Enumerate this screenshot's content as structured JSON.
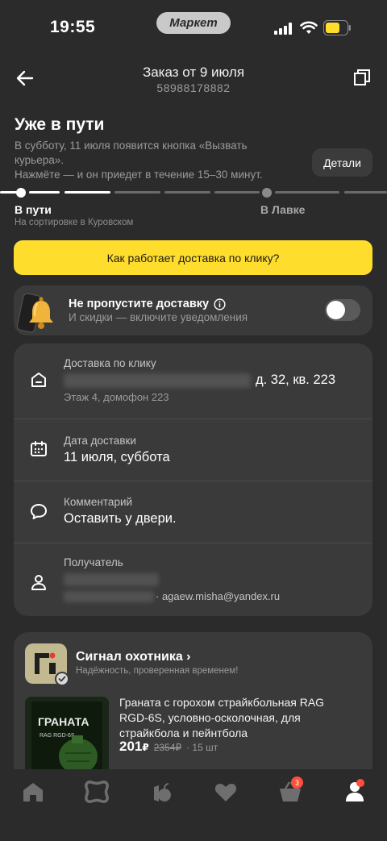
{
  "status_bar": {
    "time": "19:55",
    "pill_label": "Маркет",
    "battery_color": "#ffdd2d"
  },
  "header": {
    "title": "Заказ от 9 июля",
    "order_number": "58988178882",
    "back_icon": "arrow-left-icon",
    "copy_icon": "copy-icon"
  },
  "status": {
    "title": "Уже в пути",
    "description": "В субботу, 11 июля появится кнопка «Вызвать курьера».\nНажмёте — и он приедет в течение 15–30 минут.",
    "details_button": "Детали"
  },
  "progress": {
    "stage_current": "В пути",
    "stage_current_sub": "На сортировке в Куровском",
    "stage_next": "В Лавке",
    "accent_color": "#ffffff",
    "inactive_color": "#6a6a6a"
  },
  "delivery_button": "Как работает доставка по клику?",
  "notify": {
    "title": "Не пропустите доставку",
    "subtitle": "И скидки — включите уведомления",
    "toggle_on": false
  },
  "info": {
    "address": {
      "label": "Доставка по клику",
      "value_visible": "д. 32, кв. 223",
      "sub": "Этаж 4, домофон 223"
    },
    "date": {
      "label": "Дата доставки",
      "value": "11 июля, суббота"
    },
    "comment": {
      "label": "Комментарий",
      "value": "Оставить у двери."
    },
    "recipient": {
      "label": "Получатель",
      "email": "· agaew.misha@yandex.ru"
    }
  },
  "shop": {
    "name": "Сигнал охотника",
    "tagline": "Надёжность, проверенная временем!",
    "product_title": "Граната с горохом страйкбольная RAG RGD-6S, условно-осколочная, для страйкбола и пейнтбола",
    "price": "201",
    "currency": "₽",
    "price_old": "2354₽",
    "quantity": "· 15 шт",
    "product_image_text": "ГРАНАТА",
    "product_image_sub": "RAG RGD-6S"
  },
  "bottom_nav": {
    "items": [
      "home-icon",
      "catalog-icon",
      "lavka-icon",
      "favorites-icon",
      "cart-icon",
      "profile-icon"
    ],
    "cart_badge": "3"
  }
}
